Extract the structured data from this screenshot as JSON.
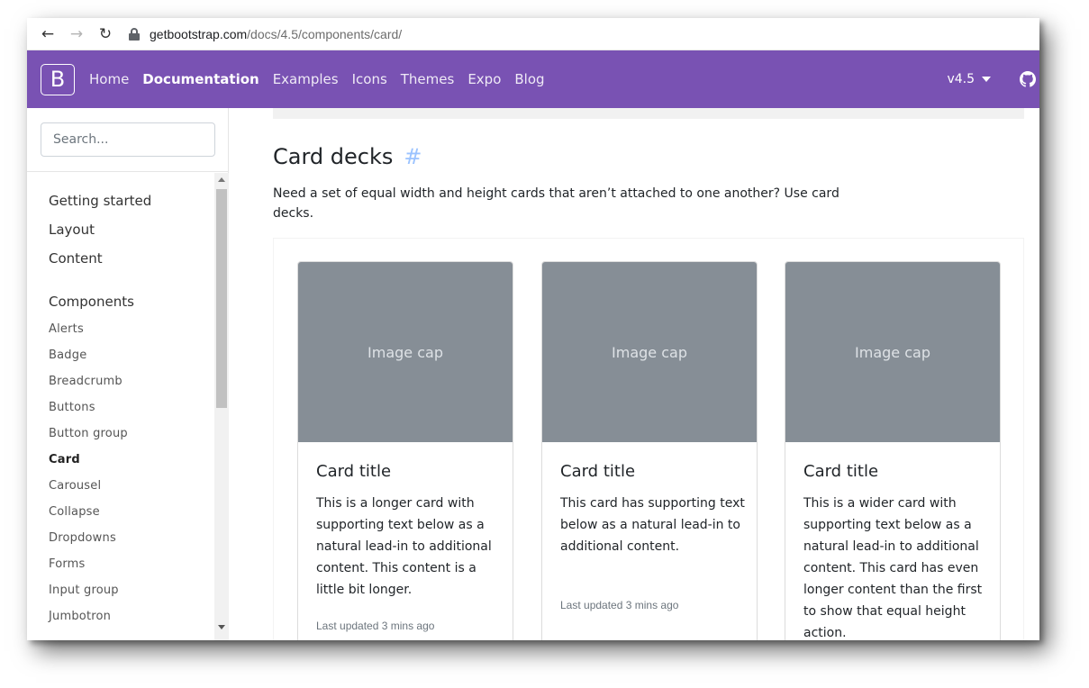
{
  "browser": {
    "url_host": "getbootstrap.com",
    "url_path": "/docs/4.5/components/card/"
  },
  "navbar": {
    "brand": "B",
    "links": [
      "Home",
      "Documentation",
      "Examples",
      "Icons",
      "Themes",
      "Expo",
      "Blog"
    ],
    "version": "v4.5",
    "accent_color": "#7952b3"
  },
  "sidebar": {
    "search_placeholder": "Search...",
    "sections": [
      "Getting started",
      "Layout",
      "Content",
      "Components"
    ],
    "items": [
      "Alerts",
      "Badge",
      "Breadcrumb",
      "Buttons",
      "Button group",
      "Card",
      "Carousel",
      "Collapse",
      "Dropdowns",
      "Forms",
      "Input group",
      "Jumbotron"
    ],
    "active_item": "Card"
  },
  "main": {
    "heading": "Card decks",
    "anchor": "#",
    "lead": "Need a set of equal width and height cards that aren’t attached to one another? Use card decks.",
    "cards": [
      {
        "image_cap": "Image cap",
        "title": "Card title",
        "text": "This is a longer card with supporting text below as a natural lead-in to additional content. This content is a little bit longer.",
        "muted": "Last updated 3 mins ago"
      },
      {
        "image_cap": "Image cap",
        "title": "Card title",
        "text": "This card has supporting text below as a natural lead-in to additional content.",
        "muted": "Last updated 3 mins ago"
      },
      {
        "image_cap": "Image cap",
        "title": "Card title",
        "text": "This is a wider card with supporting text below as a natural lead-in to additional content. This card has even longer content than the first to show that equal height action.",
        "muted": ""
      }
    ]
  }
}
